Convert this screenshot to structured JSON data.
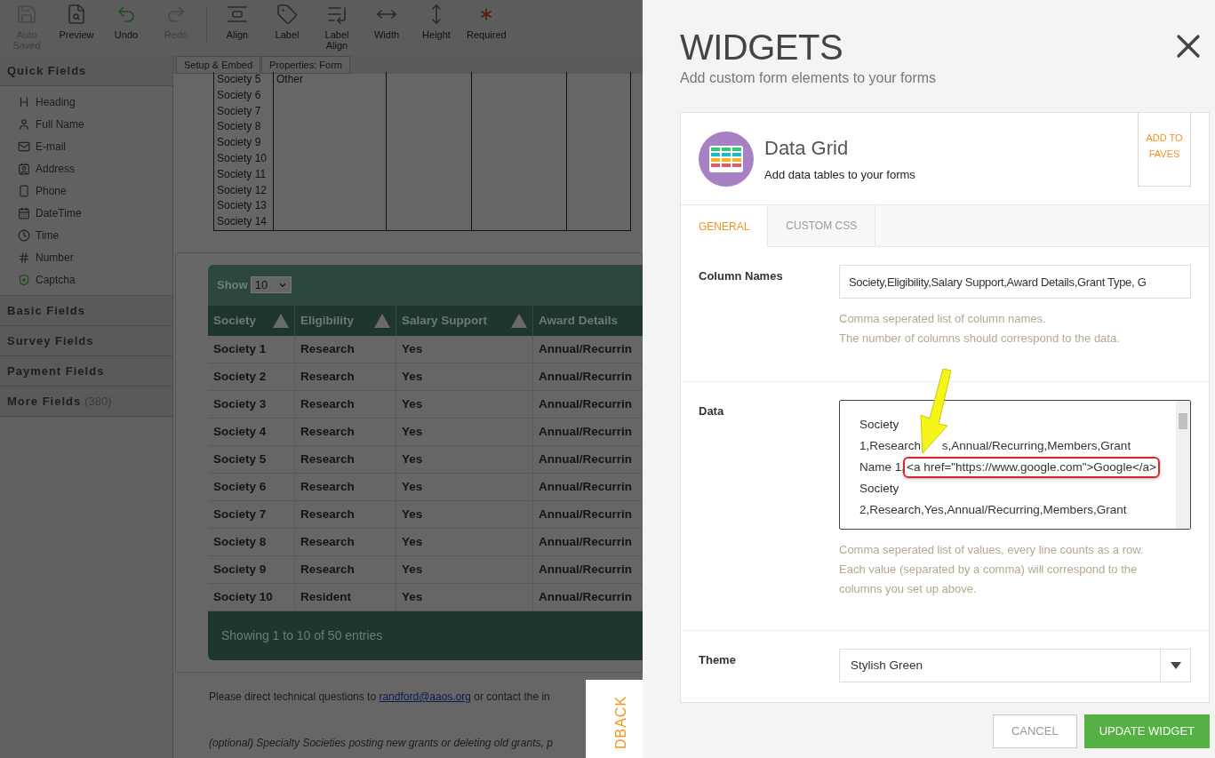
{
  "toolbar": [
    {
      "label": "Auto Saved",
      "disabled": true
    },
    {
      "label": "Preview",
      "disabled": false
    },
    {
      "label": "Undo",
      "disabled": false
    },
    {
      "label": "Redo",
      "disabled": true
    },
    {
      "label": "Align",
      "disabled": false
    },
    {
      "label": "Label",
      "disabled": false
    },
    {
      "label": "Label Align",
      "disabled": false
    },
    {
      "label": "Width",
      "disabled": false
    },
    {
      "label": "Height",
      "disabled": false
    },
    {
      "label": "Required",
      "disabled": false
    }
  ],
  "canvas_tabs": [
    "Setup & Embed",
    "Properties: Form"
  ],
  "sidebar": {
    "title": "Quick Fields",
    "items": [
      "Heading",
      "Full Name",
      "E-mail",
      "Address",
      "Phone",
      "DateTime",
      "Time",
      "Number",
      "Captcha"
    ],
    "sections": [
      {
        "label": "Basic Fields"
      },
      {
        "label": "Survey Fields"
      },
      {
        "label": "Payment Fields"
      },
      {
        "label": "More Fields",
        "count": "(380)"
      }
    ]
  },
  "form_table": {
    "rows": [
      [
        "Society 5",
        "Other"
      ],
      [
        "Society 6",
        ""
      ],
      [
        "Society 7",
        ""
      ],
      [
        "Society 8",
        ""
      ],
      [
        "Society 9",
        ""
      ],
      [
        "Society 10",
        ""
      ],
      [
        "Society 11",
        ""
      ],
      [
        "Society 12",
        ""
      ],
      [
        "Society 13",
        ""
      ],
      [
        "Society 14",
        ""
      ]
    ]
  },
  "grid": {
    "show_label": "Show",
    "page_size": "10",
    "columns": [
      {
        "label": "Society",
        "sortable": true
      },
      {
        "label": "Eligibility",
        "sortable": true
      },
      {
        "label": "Salary Support",
        "sortable": true
      },
      {
        "label": "Award Details",
        "sortable": false
      }
    ],
    "rows": [
      [
        "Society 1",
        "Research",
        "Yes",
        "Annual/Recurrin"
      ],
      [
        "Society 2",
        "Research",
        "Yes",
        "Annual/Recurrin"
      ],
      [
        "Society 3",
        "Research",
        "Yes",
        "Annual/Recurrin"
      ],
      [
        "Society 4",
        "Research",
        "Yes",
        "Annual/Recurrin"
      ],
      [
        "Society 5",
        "Research",
        "Yes",
        "Annual/Recurrin"
      ],
      [
        "Society 6",
        "Research",
        "Yes",
        "Annual/Recurrin"
      ],
      [
        "Society 7",
        "Research",
        "Yes",
        "Annual/Recurrin"
      ],
      [
        "Society 8",
        "Research",
        "Yes",
        "Annual/Recurrin"
      ],
      [
        "Society 9",
        "Research",
        "Yes",
        "Annual/Recurrin"
      ],
      [
        "Society 10",
        "Resident",
        "Yes",
        "Annual/Recurrin"
      ]
    ],
    "footer": "Showing 1 to 10 of 50 entries"
  },
  "footer_text": {
    "before": "Please direct technical questions to ",
    "link": "randford@aaos.org",
    "after": " or contact the in"
  },
  "footer_note": "(optional) Specialty Societies posting new grants or deleting old grants, p",
  "feedback_tab": "DBACK",
  "panel": {
    "title": "WIDGETS",
    "subtitle": "Add custom form elements to your forms",
    "widget": {
      "name": "Data Grid",
      "description": "Add data tables to your forms",
      "faves": "ADD TO FAVES"
    },
    "tabs": [
      {
        "label": "GENERAL",
        "selected": true
      },
      {
        "label": "CUSTOM CSS",
        "selected": false
      }
    ],
    "column_names": {
      "label": "Column Names",
      "value": "Society,Eligibility,Salary Support,Award Details,Grant Type, G",
      "help": [
        "Comma seperated list of column names.",
        "The number of columns should correspond to the data."
      ]
    },
    "data": {
      "label": "Data",
      "lines": [
        {
          "text": "Society"
        },
        {
          "text": "1,Research,",
          "after": "s,Annual/Recurring,Members,Grant"
        },
        {
          "text": "Name 1,",
          "highlight": "<a href=\"https://www.google.com\">Google</a>"
        },
        {
          "text": "Society"
        },
        {
          "text": "2,Research,Yes,Annual/Recurring,Members,Grant"
        }
      ],
      "help": [
        "Comma seperated list of values, every line counts as a row.",
        "Each value (separated by a comma) will correspond to the",
        "columns you set up above."
      ]
    },
    "theme": {
      "label": "Theme",
      "value": "Stylish Green"
    },
    "buttons": [
      {
        "label": "CANCEL",
        "kind": "secondary"
      },
      {
        "label": "UPDATE WIDGET",
        "kind": "primary"
      }
    ]
  }
}
